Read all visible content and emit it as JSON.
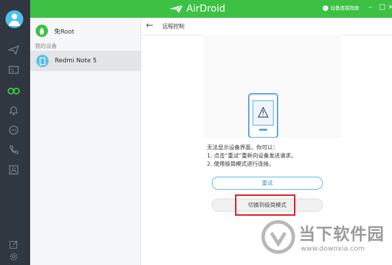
{
  "app": {
    "name": "AirDroid"
  },
  "topbar": {
    "guide_label": "设备连接指南",
    "guide_icon": "info-icon",
    "accent": "#3cc144"
  },
  "window_controls": [
    "–",
    "□",
    "×"
  ],
  "left_panel": {
    "root_label": "免Root",
    "section_label": "我的设备",
    "device_name": "Redmi Note 5"
  },
  "header": {
    "title": "远程控制"
  },
  "message": {
    "line1": "无法显示设备界面，你可以：",
    "line2": "1. 点击“重试”重新向设备发送请求。",
    "line3": "2. 使用极简模式进行连接。"
  },
  "buttons": {
    "retry": "重试",
    "switch_mode": "切换到极简模式"
  },
  "highlight_color": "#e0161c",
  "watermark": {
    "text": "当下软件园",
    "url": "www.downxia.com"
  }
}
